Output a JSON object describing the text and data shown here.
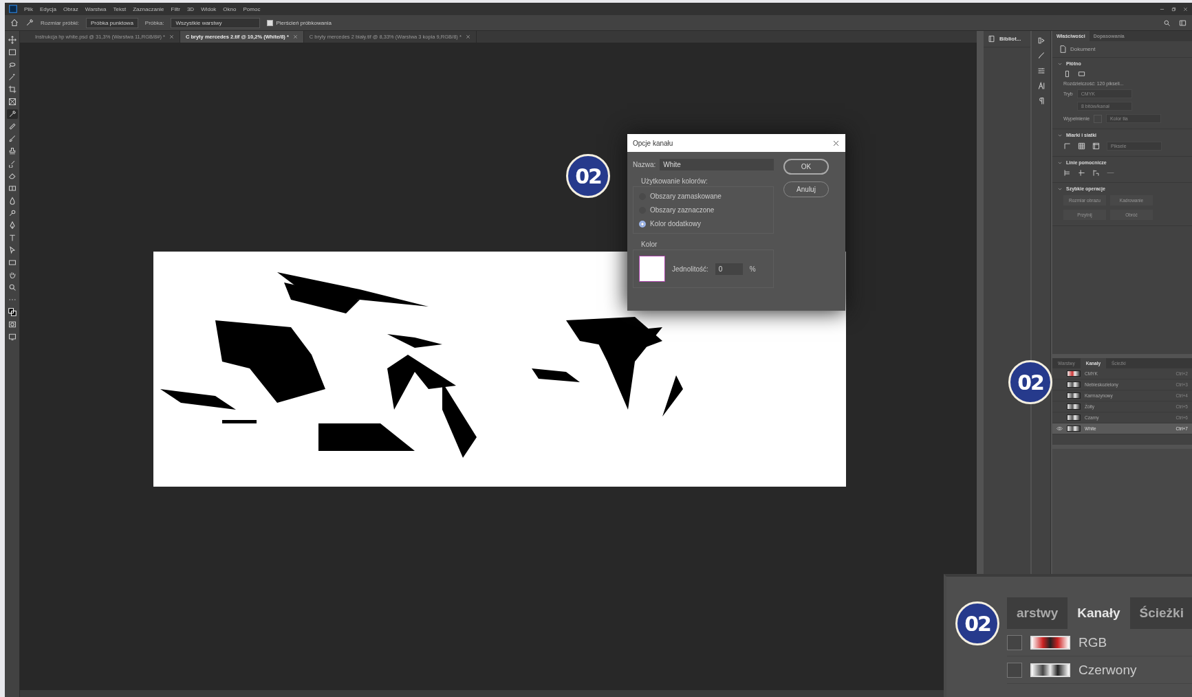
{
  "menu": {
    "items": [
      "Plik",
      "Edycja",
      "Obraz",
      "Warstwa",
      "Tekst",
      "Zaznaczanie",
      "Filtr",
      "3D",
      "Widok",
      "Okno",
      "Pomoc"
    ]
  },
  "options_bar": {
    "sample_size_label": "Rozmiar próbki:",
    "sample_size": "Próbka punktowa",
    "sample_label": "Próbka:",
    "sample": "Wszystkie warstwy",
    "ring": {
      "label": "Pierścień próbkowania",
      "checked": true
    }
  },
  "doc_tabs": [
    {
      "title": "Instrukcja hp white.psd @ 31,3% (Warstwa 11,RGB/8#) *",
      "selected": false
    },
    {
      "title": "C bryty mercedes 2.tif @ 10,2% (White/8) *",
      "selected": true
    },
    {
      "title": "C bryty mercedes 2 biały.tif @ 8,33% (Warstwa 3 kopia 9,RGB/8) *",
      "selected": false
    }
  ],
  "tools": [
    {
      "kind": "move",
      "selected": false
    },
    {
      "kind": "marquee",
      "selected": false
    },
    {
      "kind": "lasso",
      "selected": false
    },
    {
      "kind": "wand",
      "selected": false
    },
    {
      "kind": "crop",
      "selected": false
    },
    {
      "kind": "frame",
      "selected": false
    },
    {
      "kind": "eyedropper",
      "selected": true
    },
    {
      "kind": "heal",
      "selected": false
    },
    {
      "kind": "brush",
      "selected": false
    },
    {
      "kind": "stamp",
      "selected": false
    },
    {
      "kind": "history",
      "selected": false
    },
    {
      "kind": "eraser",
      "selected": false
    },
    {
      "kind": "gradient",
      "selected": false
    },
    {
      "kind": "drop",
      "selected": false
    },
    {
      "kind": "dodge",
      "selected": false
    },
    {
      "kind": "pen",
      "selected": false
    },
    {
      "kind": "type",
      "selected": false
    },
    {
      "kind": "path",
      "selected": false
    },
    {
      "kind": "shape",
      "selected": false
    },
    {
      "kind": "hand",
      "selected": false
    },
    {
      "kind": "zoom",
      "selected": false
    },
    {
      "kind": "more",
      "selected": false
    },
    {
      "kind": "colors",
      "selected": false
    },
    {
      "kind": "quickmask",
      "selected": false
    },
    {
      "kind": "screen",
      "selected": false
    }
  ],
  "dialog": {
    "title": "Opcje kanału",
    "name_label": "Nazwa:",
    "name_value": "White",
    "group_label": "Użytkowanie kolorów:",
    "options": [
      {
        "label": "Obszary zamaskowane",
        "selected": false
      },
      {
        "label": "Obszary zaznaczone",
        "selected": false
      },
      {
        "label": "Kolor dodatkowy",
        "selected": true
      }
    ],
    "color_label": "Kolor",
    "opacity_label": "Jednolitość:",
    "opacity_value": "0",
    "percent": "%",
    "buttons": [
      "OK",
      "Anuluj"
    ]
  },
  "library_panel": {
    "label": "Bibliot..."
  },
  "properties": {
    "tabs": [
      {
        "label": "Właściwości",
        "selected": true
      },
      {
        "label": "Dopasowania",
        "selected": false
      }
    ],
    "doc_label": "Dokument",
    "sections": [
      {
        "kind": "canvas",
        "title": "Płótno",
        "expanded": true,
        "resolution": "Rozdzielczość: 120 pikseli...",
        "mode_label": "Tryb",
        "mode": "CMYK",
        "depth": "8 bitów/kanał",
        "fill_label": "Wypełnienie",
        "fill": "Kolor tła"
      },
      {
        "kind": "rulers",
        "title": "Miarki i siatki",
        "expanded": true,
        "unit": "Piksele"
      },
      {
        "kind": "guides",
        "title": "Linie pomocnicze",
        "expanded": true
      },
      {
        "kind": "actions",
        "title": "Szybkie operacje",
        "expanded": true,
        "buttons": [
          "Rozmiar obrazu",
          "Kadrowanie",
          "Przytnij",
          "Obróć"
        ]
      }
    ]
  },
  "channels_panel": {
    "tabs": [
      {
        "label": "Warstwy",
        "selected": false
      },
      {
        "label": "Kanały",
        "selected": true
      },
      {
        "label": "Ścieżki",
        "selected": false
      }
    ],
    "channels": [
      {
        "name": "CMYK",
        "shortcut": "Ctrl+2",
        "kind": "composite",
        "visible": false,
        "selected": false
      },
      {
        "name": "Niebieskozielony",
        "shortcut": "Ctrl+3",
        "kind": "single",
        "visible": false,
        "selected": false
      },
      {
        "name": "Karmazynowy",
        "shortcut": "Ctrl+4",
        "kind": "single",
        "visible": false,
        "selected": false
      },
      {
        "name": "Żółty",
        "shortcut": "Ctrl+5",
        "kind": "single",
        "visible": false,
        "selected": false
      },
      {
        "name": "Czarny",
        "shortcut": "Ctrl+6",
        "kind": "single",
        "visible": false,
        "selected": false
      },
      {
        "name": "White",
        "shortcut": "Ctrl+7",
        "kind": "single",
        "visible": true,
        "selected": true
      }
    ]
  },
  "inset": {
    "tabs": [
      {
        "label": "arstwy",
        "selected": false
      },
      {
        "label": "Kanały",
        "selected": true
      },
      {
        "label": "Ścieżki",
        "selected": false
      }
    ],
    "channels": [
      {
        "name": "RGB",
        "kind": "composite"
      },
      {
        "name": "Czerwony",
        "kind": "single"
      }
    ]
  },
  "badges": [
    "02",
    "02",
    "02"
  ]
}
